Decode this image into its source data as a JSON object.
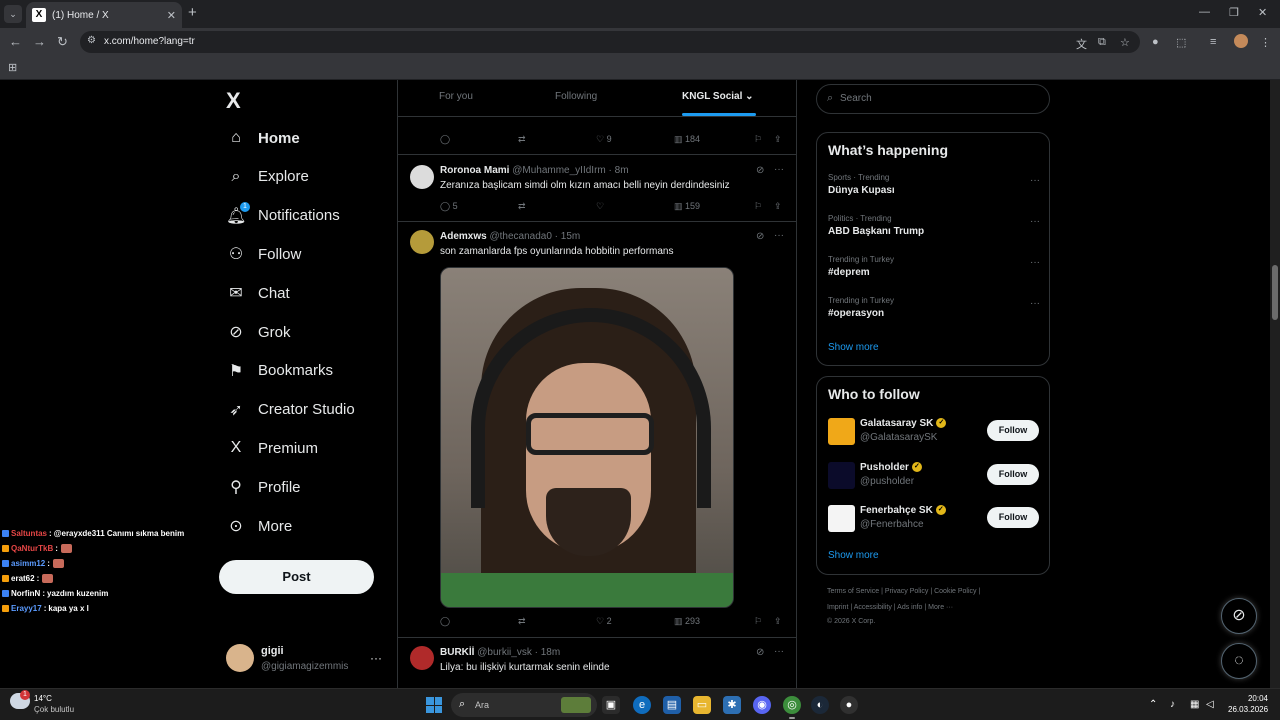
{
  "browser": {
    "tab_title": "(1) Home / X",
    "tab_favicon": "X",
    "tab_close": "✕",
    "new_tab": "+",
    "url": "x.com/home?lang=tr",
    "window_controls": [
      "—",
      "❐",
      "✕"
    ]
  },
  "chat_overlay": [
    {
      "user": "Saltuntas",
      "user_color": "#e64646",
      "text": "@erayxde311 Canımı sıkma benim",
      "mention_color": "#66b3ff",
      "emote": false
    },
    {
      "user": "QaNturTkB",
      "user_color": "#e64646",
      "text": "",
      "emote": true
    },
    {
      "user": "asimm12",
      "user_color": "#5b9bff",
      "text": "",
      "emote": true
    },
    {
      "user": "erat62",
      "user_color": "#ffffff",
      "text": "",
      "emote": true
    },
    {
      "user": "NorfinN",
      "user_color": "#ffffff",
      "text": "yazdım kuzenim",
      "emote": false
    },
    {
      "user": "Erayy17",
      "user_color": "#5b9bff",
      "text": "kapa ya x l",
      "emote": false
    }
  ],
  "left_nav": {
    "logo": "X",
    "items": [
      {
        "label": "Home",
        "icon": "home-icon",
        "glyph": "⌂"
      },
      {
        "label": "Explore",
        "icon": "search-icon",
        "glyph": "⌕"
      },
      {
        "label": "Notifications",
        "icon": "bell-icon",
        "glyph": "🔔︎",
        "badge": "1"
      },
      {
        "label": "Follow",
        "icon": "person-add-icon",
        "glyph": "⚇"
      },
      {
        "label": "Chat",
        "icon": "mail-icon",
        "glyph": "✉"
      },
      {
        "label": "Grok",
        "icon": "grok-icon",
        "glyph": "⊘"
      },
      {
        "label": "Bookmarks",
        "icon": "bookmark-icon",
        "glyph": "⚑"
      },
      {
        "label": "Creator Studio",
        "icon": "rocket-icon",
        "glyph": "➶"
      },
      {
        "label": "Premium",
        "icon": "x-premium-icon",
        "glyph": "X"
      },
      {
        "label": "Profile",
        "icon": "person-icon",
        "glyph": "⚲"
      },
      {
        "label": "More",
        "icon": "more-circle-icon",
        "glyph": "⊙"
      }
    ],
    "post_label": "Post",
    "account_name": "gigii",
    "account_handle": "@gigiamagizemmis",
    "account_more": "···"
  },
  "feed": {
    "tabs": [
      "For you",
      "Following",
      "KNGL Social"
    ],
    "top_actions": {
      "replies": "",
      "retweets": "",
      "likes": "9",
      "views": "184"
    },
    "tweets": [
      {
        "name": "Roronoa Mami",
        "handle": "@Muhamme_yIIdIrm",
        "time": "8m",
        "text": "Zeranıza başlicam simdi olm kızın amacı belli neyin derdindesiniz",
        "replies": "5",
        "retweets": "",
        "likes": "",
        "views": "159",
        "avatar_color": "#dcdcdc"
      },
      {
        "name": "Ademxws",
        "handle": "@thecanada0",
        "time": "15m",
        "text": "son zamanlarda fps oyunlarında hobbitin performans",
        "replies": "",
        "retweets": "",
        "likes": "2",
        "views": "293",
        "avatar_color": "#b59b3a"
      },
      {
        "name": "BURKİİ",
        "handle": "@burkii_vsk",
        "time": "18m",
        "text": "Lilya: bu ilişkiyi kurtarmak senin elinde",
        "avatar_color": "#b02a2a"
      }
    ]
  },
  "right": {
    "search_placeholder": "Search",
    "trends_title": "What’s happening",
    "trends": [
      {
        "context": "Sports · Trending",
        "title": "Dünya Kupası"
      },
      {
        "context": "Politics · Trending",
        "title": "ABD Başkanı Trump"
      },
      {
        "context": "Trending in Turkey",
        "title": "#deprem"
      },
      {
        "context": "Trending in Turkey",
        "title": "#operasyon"
      }
    ],
    "show_more": "Show more",
    "wtf_title": "Who to follow",
    "suggestions": [
      {
        "name": "Galatasaray SK",
        "handle": "@GalatasaraySK",
        "logo_color": "#f0a818"
      },
      {
        "name": "Pusholder",
        "handle": "@pusholder",
        "logo_color": "#0b0b2a"
      },
      {
        "name": "Fenerbahçe SK",
        "handle": "@Fenerbahce",
        "logo_color": "#f4f4f4"
      }
    ],
    "follow_label": "Follow",
    "footer_line1": "Terms of Service  |  Privacy Policy  |  Cookie Policy  |",
    "footer_line2": "Imprint  |  Accessibility  |  Ads info  |  More ···",
    "footer_line3": "© 2026 X Corp."
  },
  "taskbar": {
    "temperature": "14°C",
    "weather": "Çok bulutlu",
    "weather_badge": "1",
    "search_placeholder": "Ara",
    "time": "20:04",
    "date": "26.03.2026"
  },
  "colors": {
    "accent": "#1d9bf0",
    "background": "#000000",
    "border": "#2f3336",
    "muted": "#71767b"
  }
}
